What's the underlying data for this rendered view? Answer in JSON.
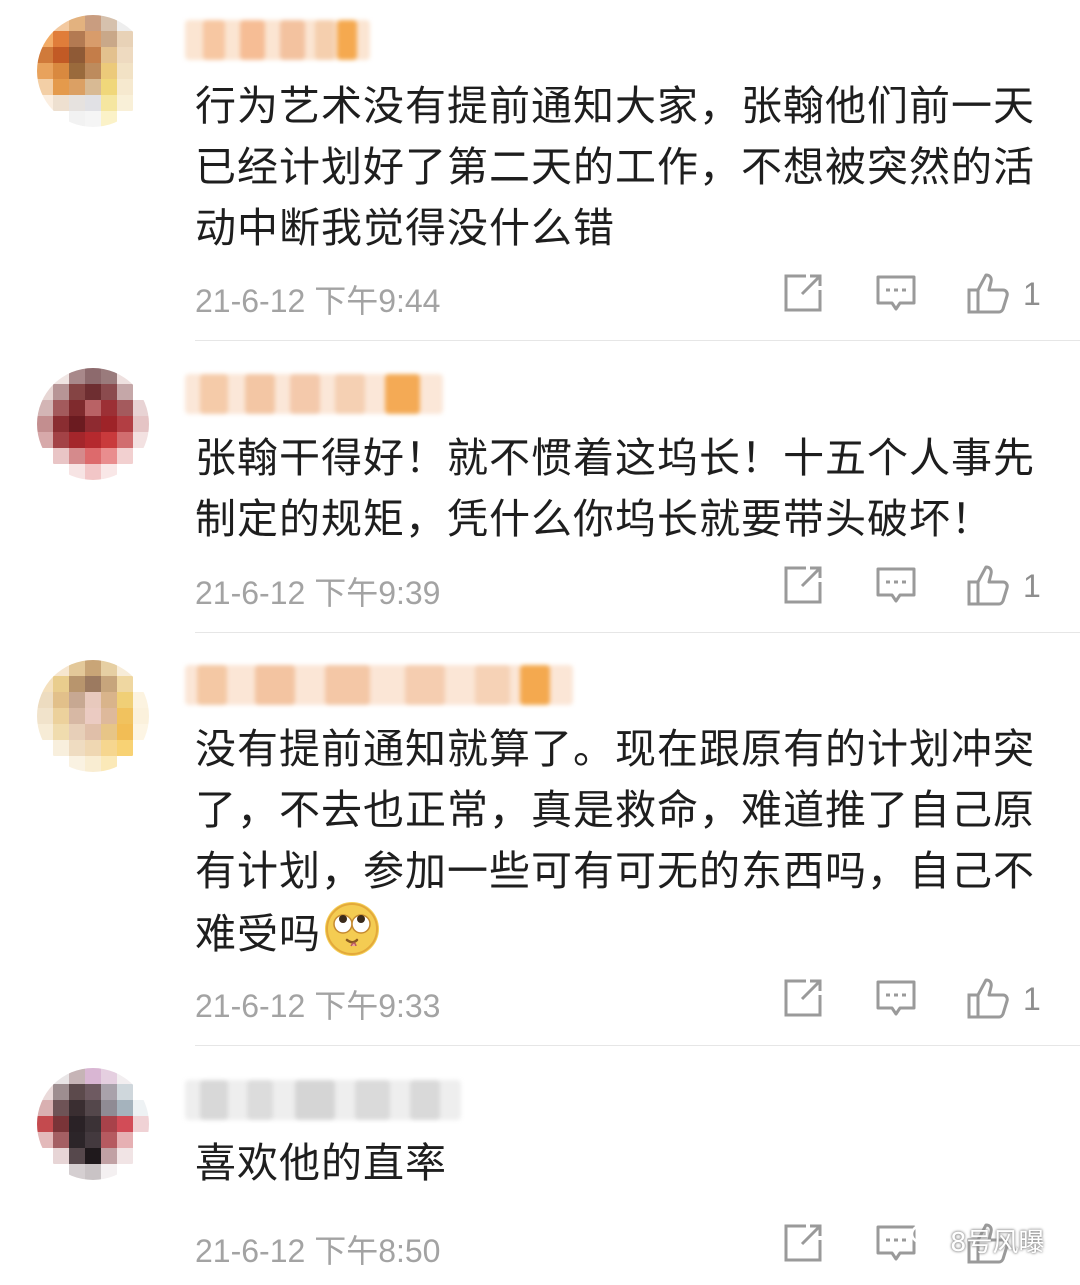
{
  "comments": [
    {
      "text": "行为艺术没有提前通知大家，张翰他们前一天已经计划好了第二天的工作，不想被突然的活动中断我觉得没什么错",
      "time": "21-6-12 下午9:44",
      "likes": "1"
    },
    {
      "text": "张翰干得好！就不惯着这坞长！十五个人事先制定的规矩，凭什么你坞长就要带头破坏！",
      "time": "21-6-12 下午9:39",
      "likes": "1"
    },
    {
      "text": "没有提前通知就算了。现在跟原有的计划冲突了，不去也正常，真是救命，难道推了自己原有计划，参加一些可有可无的东西吗，自己不难受吗",
      "emoji": "eye-roll-emoji",
      "time": "21-6-12 下午9:33",
      "likes": "1"
    },
    {
      "text": "喜欢他的直率",
      "time": "21-6-12 下午8:50",
      "likes": ""
    }
  ],
  "icons": {
    "share": "share-icon",
    "reply": "comment-icon",
    "like": "thumbs-up-icon"
  },
  "colors": {
    "text": "#1e1e1e",
    "meta": "#a3a3a3",
    "divider": "#e6e6e6"
  },
  "watermark": {
    "label": "8号风曝",
    "icon": "wechat-icon"
  }
}
